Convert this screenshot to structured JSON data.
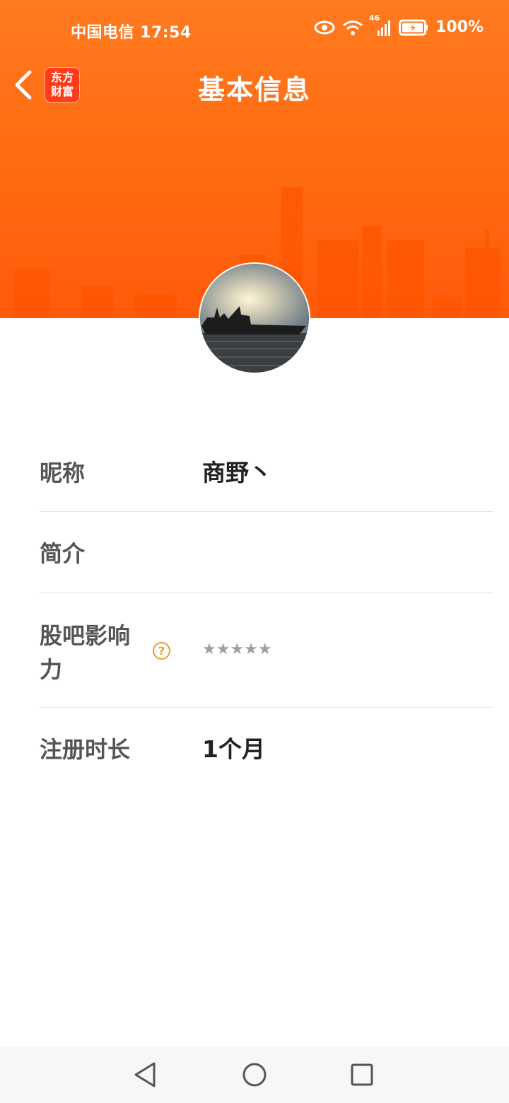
{
  "status_bar": {
    "carrier_time": "中国电信 17:54",
    "network": "46",
    "battery": "100%",
    "icons": [
      "eye-icon",
      "wifi-icon",
      "signal-icon",
      "battery-icon"
    ]
  },
  "header": {
    "title": "基本信息",
    "logo_line1": "东方",
    "logo_line2": "财富",
    "back_icon": "chevron-left-icon"
  },
  "profile": {
    "rows": [
      {
        "label": "昵称",
        "value": "商野丶"
      },
      {
        "label": "简介",
        "value": ""
      },
      {
        "label_line1": "股吧影响",
        "label_line2": "力",
        "help": "?",
        "stars": "★★★★★",
        "star_count": 0
      },
      {
        "label": "注册时长",
        "value": "1个月"
      }
    ]
  },
  "nav": {
    "buttons": [
      "back-triangle-icon",
      "home-circle-icon",
      "recents-square-icon"
    ]
  },
  "colors": {
    "accent": "#ff6a10",
    "logo": "#ff3b1a",
    "help": "#f0a030"
  }
}
